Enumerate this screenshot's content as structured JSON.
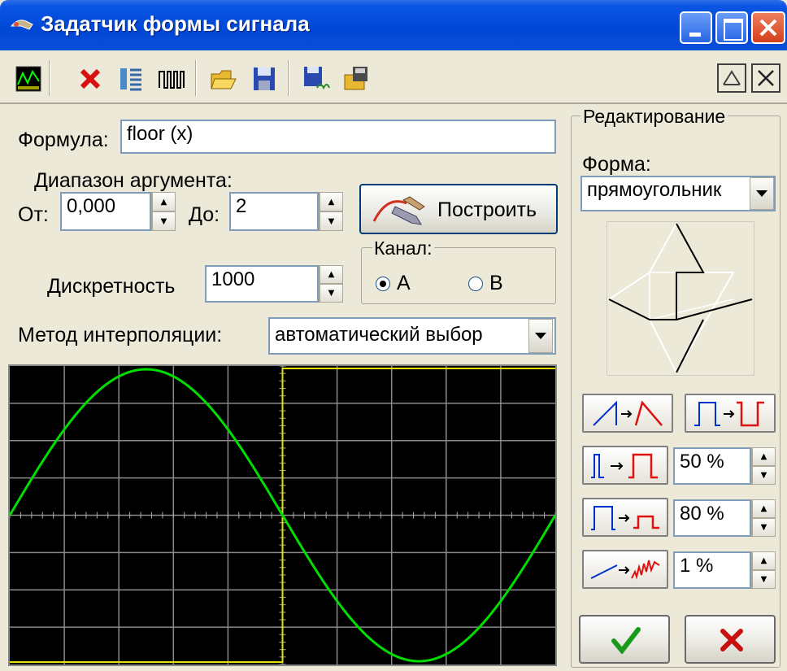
{
  "window": {
    "title": "Задатчик формы сигнала"
  },
  "toolbar": {
    "icons": [
      "oscilloscope-icon",
      "delete-icon",
      "list-icon",
      "pulse-icon",
      "open-folder-icon",
      "save-disk-icon",
      "save-as-icon",
      "export-icon"
    ],
    "right_icons": [
      "minimize-pane-icon",
      "close-pane-icon"
    ]
  },
  "form": {
    "formula_label": "Формула:",
    "formula_value": "floor (x)",
    "range_label": "Диапазон аргумента:",
    "from_label": "От:",
    "from_value": "0,000",
    "to_label": "До:",
    "to_value": "2",
    "build_button": "Построить",
    "discreteness_label": "Дискретность",
    "discreteness_value": "1000",
    "channel_label": "Канал:",
    "channel_a": "A",
    "channel_b": "B",
    "channel_selected": "A",
    "interp_label": "Метод интерполяции:",
    "interp_value": "автоматический выбор"
  },
  "editing": {
    "group_label": "Редактирование",
    "shape_label": "Форма:",
    "shape_value": "прямоугольник",
    "duty_value": "50 %",
    "amplitude_value": "80 %",
    "noise_value": "1 %"
  },
  "colors": {
    "sine": "#00dd00",
    "square": "#e8e000",
    "ok": "#1a9a1a",
    "cancel": "#c81010"
  }
}
